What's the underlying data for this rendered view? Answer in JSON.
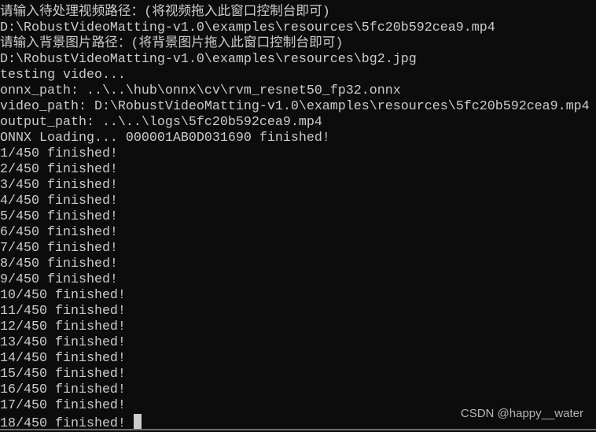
{
  "console": {
    "lines": [
      "请输入待处理视频路径：(将视频拖入此窗口控制台即可)",
      "D:\\RobustVideoMatting-v1.0\\examples\\resources\\5fc20b592cea9.mp4",
      "请输入背景图片路径：(将背景图片拖入此窗口控制台即可)",
      "D:\\RobustVideoMatting-v1.0\\examples\\resources\\bg2.jpg",
      "testing video...",
      "onnx_path: ..\\..\\hub\\onnx\\cv\\rvm_resnet50_fp32.onnx",
      "video_path: D:\\RobustVideoMatting-v1.0\\examples\\resources\\5fc20b592cea9.mp4",
      "output_path: ..\\..\\logs\\5fc20b592cea9.mp4",
      "ONNX Loading... 000001AB0D031690 finished!",
      "1/450 finished!",
      "2/450 finished!",
      "3/450 finished!",
      "4/450 finished!",
      "5/450 finished!",
      "6/450 finished!",
      "7/450 finished!",
      "8/450 finished!",
      "9/450 finished!",
      "10/450 finished!",
      "11/450 finished!",
      "12/450 finished!",
      "13/450 finished!",
      "14/450 finished!",
      "15/450 finished!",
      "16/450 finished!",
      "17/450 finished!",
      "18/450 finished! "
    ]
  },
  "watermark": "CSDN @happy__water",
  "colors": {
    "background": "#0c0c0c",
    "text": "#cccccc"
  }
}
